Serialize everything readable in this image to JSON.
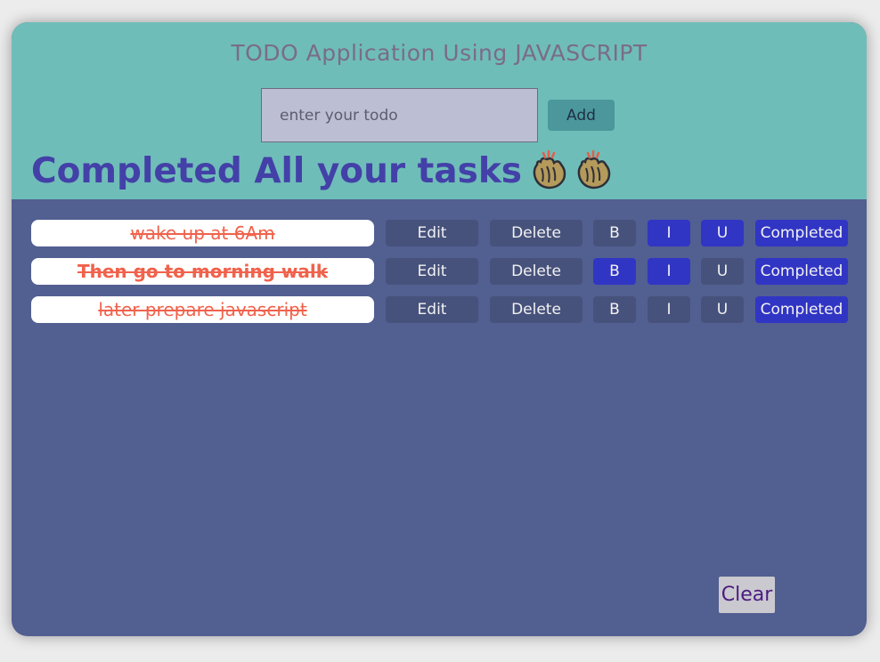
{
  "header": {
    "title": "TODO Application Using JAVASCRIPT",
    "input_placeholder": "enter your todo",
    "input_value": "",
    "add_label": "Add"
  },
  "status_message": "Completed All your tasks",
  "status_icons": [
    "clapping-hands-icon",
    "clapping-hands-icon"
  ],
  "todos": [
    {
      "text": "wake up at 6Am",
      "completed": true,
      "bold": false,
      "italic": true,
      "underline": true,
      "edit_label": "Edit",
      "delete_label": "Delete",
      "bold_label": "B",
      "italic_label": "I",
      "underline_label": "U",
      "completed_label": "Completed"
    },
    {
      "text": "Then go to morning walk",
      "completed": true,
      "bold": true,
      "italic": true,
      "underline": false,
      "edit_label": "Edit",
      "delete_label": "Delete",
      "bold_label": "B",
      "italic_label": "I",
      "underline_label": "U",
      "completed_label": "Completed"
    },
    {
      "text": "later prepare javascript",
      "completed": true,
      "bold": false,
      "italic": false,
      "underline": false,
      "edit_label": "Edit",
      "delete_label": "Delete",
      "bold_label": "B",
      "italic_label": "I",
      "underline_label": "U",
      "completed_label": "Completed"
    }
  ],
  "clear_label": "Clear",
  "colors": {
    "header_bg": "#6fbdb8",
    "body_bg": "#525f91",
    "accent_blue": "#3135c4",
    "todo_text": "#f0624c",
    "status_text": "#4340a8"
  }
}
